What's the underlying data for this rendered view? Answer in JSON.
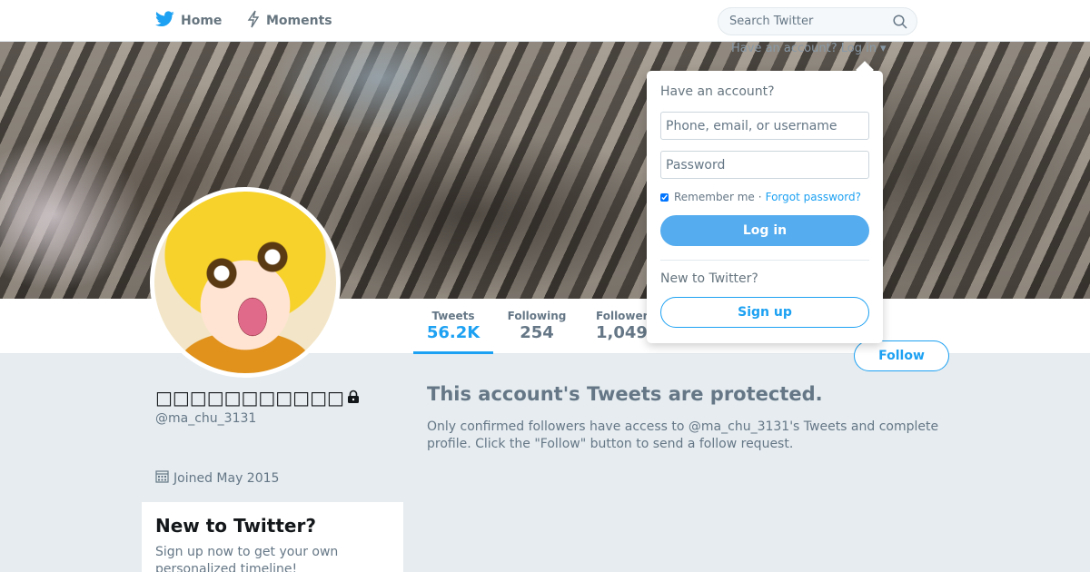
{
  "nav": {
    "home_label": "Home",
    "moments_label": "Moments",
    "search_placeholder": "Search Twitter"
  },
  "banner": {
    "login_peek": "Have an account? Log in ▾"
  },
  "profile": {
    "name": "□□□□□□□□□□□",
    "handle": "@ma_chu_3131",
    "joined": "Joined May 2015",
    "protected": true
  },
  "stats": {
    "tweets": {
      "label": "Tweets",
      "value": "56.2K"
    },
    "following": {
      "label": "Following",
      "value": "254"
    },
    "followers": {
      "label": "Followers",
      "value": "1,049"
    }
  },
  "follow_button": "Follow",
  "protected_notice": {
    "title": "This account's Tweets are protected.",
    "body": "Only confirmed followers have access to @ma_chu_3131's Tweets and complete profile. Click the \"Follow\" button to send a follow request."
  },
  "signup_card": {
    "title": "New to Twitter?",
    "body": "Sign up now to get your own personalized timeline!"
  },
  "login_dropdown": {
    "heading": "Have an account?",
    "username_placeholder": "Phone, email, or username",
    "password_placeholder": "Password",
    "remember_label": "Remember me",
    "separator": "·",
    "forgot_label": "Forgot password?",
    "login_button": "Log in",
    "new_heading": "New to Twitter?",
    "signup_button": "Sign up"
  },
  "colors": {
    "brand": "#1da1f2",
    "login_button": "#55acee",
    "page_background": "#e6ecf0"
  }
}
